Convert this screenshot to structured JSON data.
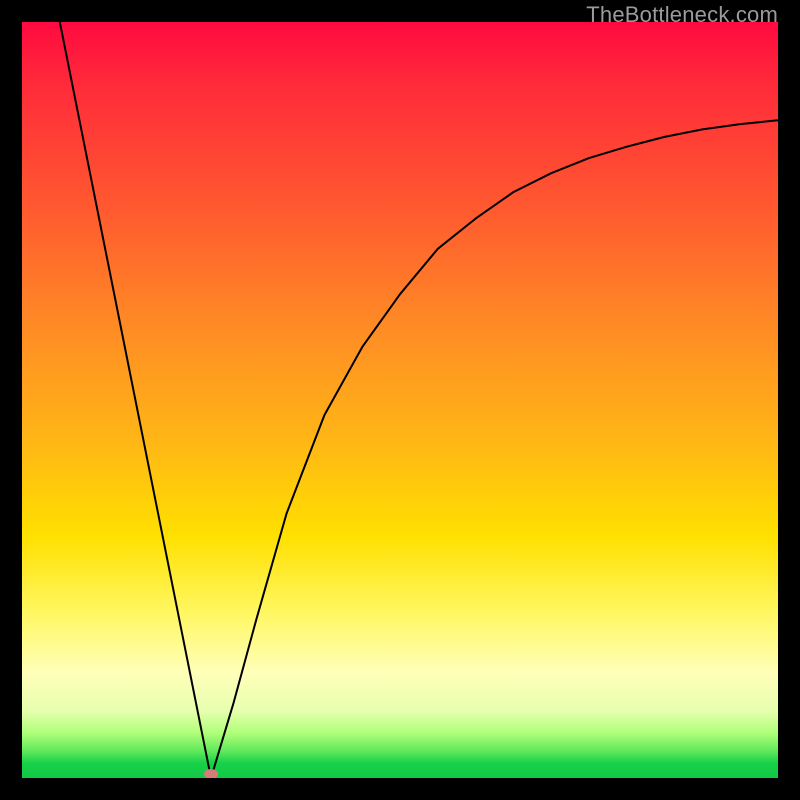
{
  "watermark": "TheBottleneck.com",
  "chart_data": {
    "type": "line",
    "title": "",
    "xlabel": "",
    "ylabel": "",
    "xlim": [
      0,
      100
    ],
    "ylim": [
      0,
      100
    ],
    "grid": false,
    "legend": false,
    "series": [
      {
        "name": "left-segment",
        "description": "Steep descending line on left side",
        "points": [
          {
            "x": 5,
            "y": 100
          },
          {
            "x": 25,
            "y": 0
          }
        ]
      },
      {
        "name": "right-segment",
        "description": "Rising curve that flattens toward top-right",
        "points": [
          {
            "x": 25,
            "y": 0
          },
          {
            "x": 28,
            "y": 10
          },
          {
            "x": 31,
            "y": 21
          },
          {
            "x": 35,
            "y": 35
          },
          {
            "x": 40,
            "y": 48
          },
          {
            "x": 45,
            "y": 57
          },
          {
            "x": 50,
            "y": 64
          },
          {
            "x": 55,
            "y": 70
          },
          {
            "x": 60,
            "y": 74
          },
          {
            "x": 65,
            "y": 77.5
          },
          {
            "x": 70,
            "y": 80
          },
          {
            "x": 75,
            "y": 82
          },
          {
            "x": 80,
            "y": 83.5
          },
          {
            "x": 85,
            "y": 84.8
          },
          {
            "x": 90,
            "y": 85.8
          },
          {
            "x": 95,
            "y": 86.5
          },
          {
            "x": 100,
            "y": 87
          }
        ]
      }
    ],
    "marker": {
      "x": 25,
      "y": 0,
      "note": "small pink ellipse at the minimum / bottleneck point"
    },
    "gradient_colors": {
      "top": "#ff0a40",
      "mid_orange": "#ff8a25",
      "mid_yellow": "#ffe000",
      "bottom": "#12c846"
    }
  }
}
